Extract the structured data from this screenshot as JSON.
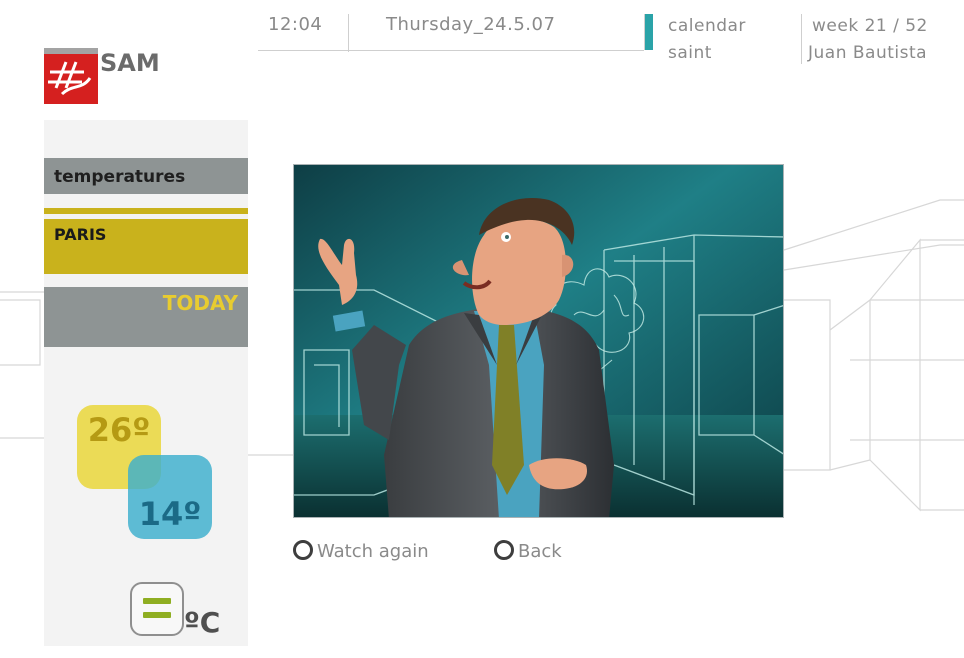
{
  "header": {
    "time": "12:04",
    "date": "Thursday_24.5.07",
    "calendar_label": "calendar",
    "saint_label": "saint",
    "week": "week 21 / 52",
    "saint_name": "Juan Bautista"
  },
  "logo": {
    "text": "SAM",
    "color": "#d5201f"
  },
  "panel": {
    "section_label": "temperatures",
    "city": "PARIS",
    "day": "TODAY"
  },
  "temperatures": {
    "high": "26º",
    "low": "14º",
    "unit_label": "ºC"
  },
  "controls": {
    "watch_again": "Watch again",
    "back": "Back"
  },
  "colors": {
    "accent_yellow": "#c9b21c",
    "panel_gray": "#8e9494",
    "high_temp": "#e9d63a",
    "low_temp": "#3cafcd",
    "calendar_marker": "#2aa3a8",
    "unit_green": "#8fae22"
  },
  "icons": [
    "sam-logo-icon",
    "radio-ring-icon",
    "equals-icon"
  ]
}
